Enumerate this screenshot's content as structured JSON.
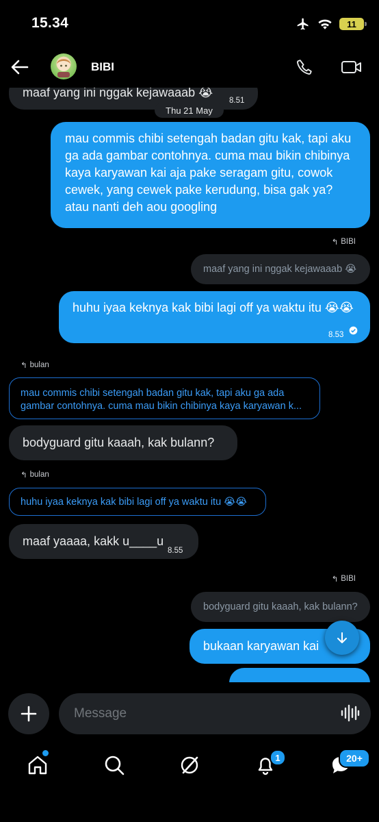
{
  "status_bar": {
    "time": "15.34",
    "battery": "11"
  },
  "header": {
    "contact_name": "BIBI"
  },
  "messages": {
    "m1_text": "maaf yang ini nggak kejawaaab 😭",
    "m1_time": "8.51",
    "date_divider": "Thu 21 May",
    "m2_text": "mau commis chibi setengah badan gitu kak, tapi aku ga ada gambar contohnya. cuma mau bikin chibinya kaya karyawan kai aja pake seragam gitu, cowok cewek, yang cewek pake kerudung, bisa gak ya? atau nanti deh aou googling",
    "m3_reply_to": "BIBI",
    "m3_quote": "maaf yang ini nggak kejawaaab 😭",
    "m3_text": "huhu iyaa keknya kak bibi lagi off ya waktu itu 😭😭",
    "m3_time": "8.53",
    "m4_reply_to": "bulan",
    "m4_quote": "mau commis chibi setengah badan gitu kak, tapi aku ga ada gambar contohnya. cuma mau bikin chibinya kaya karyawan k...",
    "m4_text": "bodyguard gitu kaaah, kak bulann?",
    "m5_reply_to": "bulan",
    "m5_quote": "huhu iyaa keknya kak bibi lagi off ya waktu itu 😭😭",
    "m5_text": "maaf yaaaa, kakk u____u",
    "m5_time": "8.55",
    "m6_reply_to": "BIBI",
    "m6_quote": "bodyguard gitu kaaah, kak bulann?",
    "m6_text": "bukaan karyawan kai"
  },
  "composer": {
    "placeholder": "Message"
  },
  "nav": {
    "notifications_badge": "1",
    "messages_badge": "20+"
  },
  "colors": {
    "accent": "#1d9bf0",
    "incoming_bubble": "#202327",
    "background": "#000000"
  },
  "icons": [
    "back-arrow-icon",
    "phone-icon",
    "video-icon",
    "plus-icon",
    "voice-icon",
    "home-icon",
    "search-icon",
    "grok-icon",
    "bell-icon",
    "messages-icon",
    "arrow-down-icon",
    "reply-icon",
    "check-icon",
    "airplane-icon",
    "wifi-icon"
  ]
}
